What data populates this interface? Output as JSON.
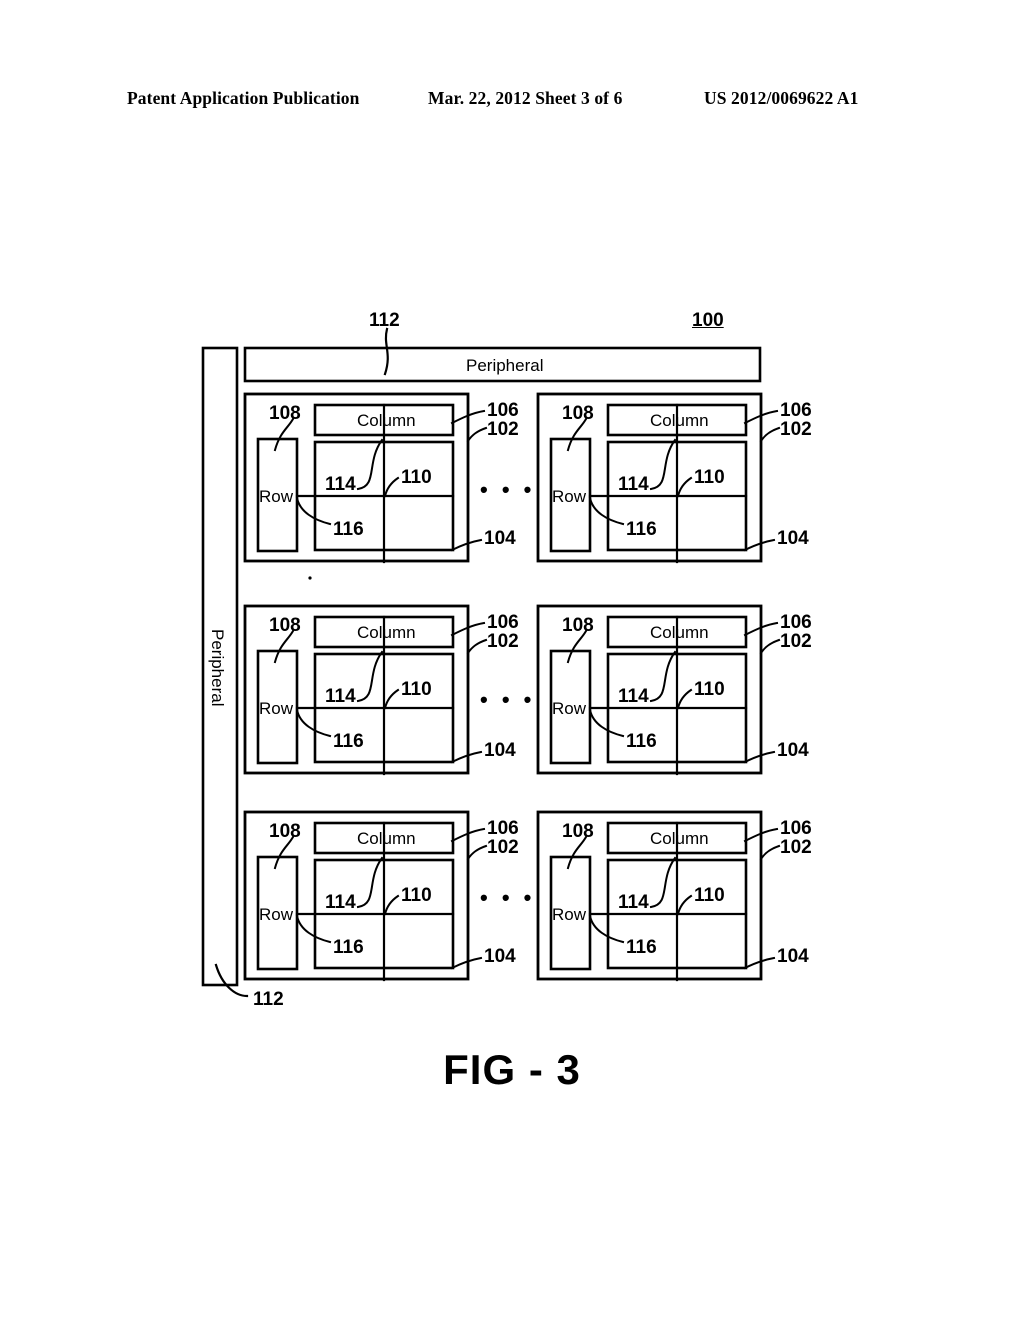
{
  "header": {
    "left": "Patent Application Publication",
    "center": "Mar. 22, 2012  Sheet 3 of 6",
    "right": "US 2012/0069622 A1"
  },
  "figure": {
    "caption": "FIG - 3",
    "overall_ref": "100",
    "peripheral_top": {
      "label": "Peripheral",
      "ref": "112"
    },
    "peripheral_left": {
      "label": "Peripheral",
      "ref": "112"
    },
    "ellipsis": "•  •  •",
    "block_refs": {
      "bank": "102",
      "array": "104",
      "column_decoder": "106",
      "row_decoder": "108",
      "cell": "110",
      "bitline": "114",
      "wordline": "116"
    },
    "block_labels": {
      "column": "Column",
      "row": "Row"
    },
    "blocks": [
      {
        "id": "r1c1",
        "row": 1,
        "col": 1,
        "column_label": "Column",
        "row_label": "Row",
        "refs": {
          "bank": "102",
          "array": "104",
          "column_decoder": "106",
          "row_decoder": "108",
          "cell": "110",
          "bitline": "114",
          "wordline": "116"
        }
      },
      {
        "id": "r1c2",
        "row": 1,
        "col": 2,
        "column_label": "Column",
        "row_label": "Row",
        "refs": {
          "bank": "102",
          "array": "104",
          "column_decoder": "106",
          "row_decoder": "108",
          "cell": "110",
          "bitline": "114",
          "wordline": "116"
        }
      },
      {
        "id": "r2c1",
        "row": 2,
        "col": 1,
        "column_label": "Column",
        "row_label": "Row",
        "refs": {
          "bank": "102",
          "array": "104",
          "column_decoder": "106",
          "row_decoder": "108",
          "cell": "110",
          "bitline": "114",
          "wordline": "116"
        }
      },
      {
        "id": "r2c2",
        "row": 2,
        "col": 2,
        "column_label": "Column",
        "row_label": "Row",
        "refs": {
          "bank": "102",
          "array": "104",
          "column_decoder": "106",
          "row_decoder": "108",
          "cell": "110",
          "bitline": "114",
          "wordline": "116"
        }
      },
      {
        "id": "r3c1",
        "row": 3,
        "col": 1,
        "column_label": "Column",
        "row_label": "Row",
        "refs": {
          "bank": "102",
          "array": "104",
          "column_decoder": "106",
          "row_decoder": "108",
          "cell": "110",
          "bitline": "114",
          "wordline": "116"
        }
      },
      {
        "id": "r3c2",
        "row": 3,
        "col": 2,
        "column_label": "Column",
        "row_label": "Row",
        "refs": {
          "bank": "102",
          "array": "104",
          "column_decoder": "106",
          "row_decoder": "108",
          "cell": "110",
          "bitline": "114",
          "wordline": "116"
        }
      }
    ]
  },
  "colors": {
    "ink": "#000000",
    "paper": "#ffffff"
  }
}
